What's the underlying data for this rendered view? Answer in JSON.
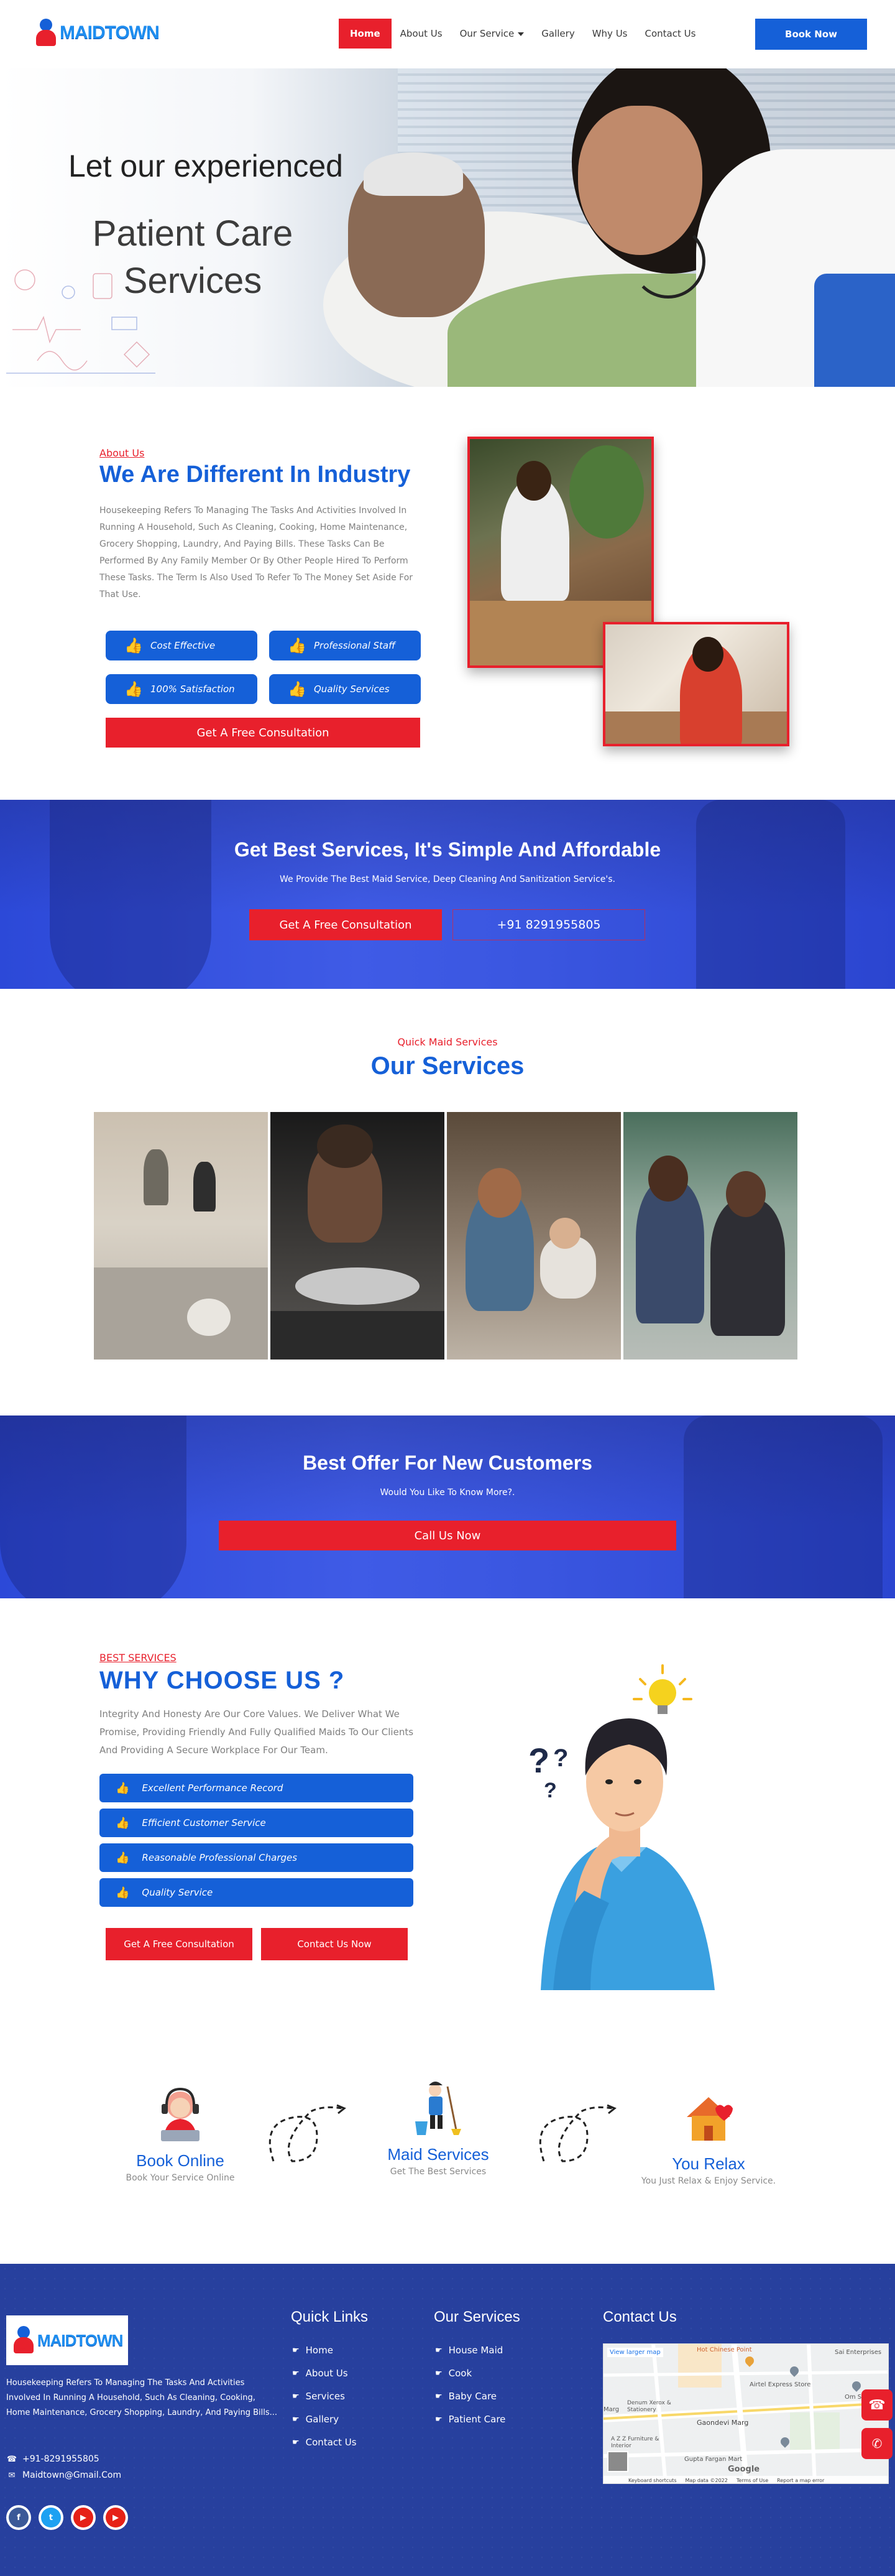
{
  "header": {
    "logo_text": "MAIDTOWN",
    "nav": [
      {
        "label": "Home",
        "active": true
      },
      {
        "label": "About Us"
      },
      {
        "label": "Our Service"
      },
      {
        "label": "Gallery"
      },
      {
        "label": "Why Us"
      },
      {
        "label": "Contact Us"
      }
    ],
    "book_label": "Book Now"
  },
  "hero": {
    "line1": "Let our experienced",
    "line2": "Patient Care Services"
  },
  "about": {
    "eyebrow": "About Us",
    "title": "We Are Different In Industry",
    "body": "Housekeeping Refers To Managing The Tasks And Activities Involved In Running A Household, Such As Cleaning, Cooking, Home Maintenance, Grocery Shopping, Laundry, And Paying Bills. These Tasks Can Be Performed By Any Family Member Or By Other People Hired To Perform These Tasks. The Term Is Also Used To Refer To The Money Set Aside For That Use.",
    "features": [
      "Cost Effective",
      "Professional Staff",
      "100% Satisfaction",
      "Quality Services"
    ],
    "cta": "Get A Free Consultation"
  },
  "banner1": {
    "title": "Get Best Services, It's Simple And Affordable",
    "subtitle": "We Provide The Best Maid Service, Deep Cleaning And Sanitization Service's.",
    "cta": "Get A Free Consultation",
    "phone": "+91 8291955805"
  },
  "services": {
    "eyebrow": "Quick Maid Services",
    "title": "Our Services"
  },
  "banner2": {
    "title": "Best Offer For New Customers",
    "subtitle": "Would You Like To Know More?.",
    "cta": "Call Us Now"
  },
  "why": {
    "eyebrow": "BEST SERVICES",
    "title": "WHY CHOOSE US ?",
    "body": "Integrity And Honesty Are Our Core Values. We Deliver What We Promise, Providing Friendly And Fully Qualified Maids To Our Clients And Providing A Secure Workplace For Our Team.",
    "items": [
      "Excellent Performance Record",
      "Efficient Customer Service",
      "Reasonable Professional Charges",
      "Quality Service"
    ],
    "btn_consult": "Get A Free Consultation",
    "btn_contact": "Contact Us Now"
  },
  "process": [
    {
      "title": "Book Online",
      "desc": "Book Your Service Online"
    },
    {
      "title": "Maid Services",
      "desc": "Get The Best Services"
    },
    {
      "title": "You Relax",
      "desc": "You Just Relax & Enjoy Service."
    }
  ],
  "footer": {
    "logo_text": "MAIDTOWN",
    "about": "Housekeeping Refers To Managing The Tasks And Activities Involved In Running A Household, Such As Cleaning, Cooking, Home Maintenance, Grocery Shopping, Laundry, And Paying Bills...",
    "phone": "+91-8291955805",
    "email": "Maidtown@Gmail.Com",
    "quick_links_title": "Quick Links",
    "quick_links": [
      "Home",
      "About Us",
      "Services",
      "Gallery",
      "Contact Us"
    ],
    "services_title": "Our Services",
    "services": [
      "House Maid",
      "Cook",
      "Baby Care",
      "Patient Care"
    ],
    "contact_title": "Contact Us",
    "map": {
      "view_larger": "View larger map",
      "places": [
        "Hot Chinese Point",
        "Sai Enterprises",
        "Airtel Express Store",
        "Om Sai Cr",
        "Denum Xerox & Stationery",
        "Gaondevi Marg",
        "A Z Z Furniture & Interior",
        "Gupta Fargan Mart",
        "Marg"
      ],
      "footer_items": [
        "Keyboard shortcuts",
        "Map data ©2022",
        "Terms of Use",
        "Report a map error"
      ],
      "brand": "Google"
    },
    "socials": [
      "facebook-icon",
      "twitter-icon",
      "youtube-icon",
      "youtube-icon"
    ]
  },
  "colors": {
    "primary_blue": "#1560d8",
    "accent_red": "#e8202c",
    "footer_blue": "#27409e"
  }
}
